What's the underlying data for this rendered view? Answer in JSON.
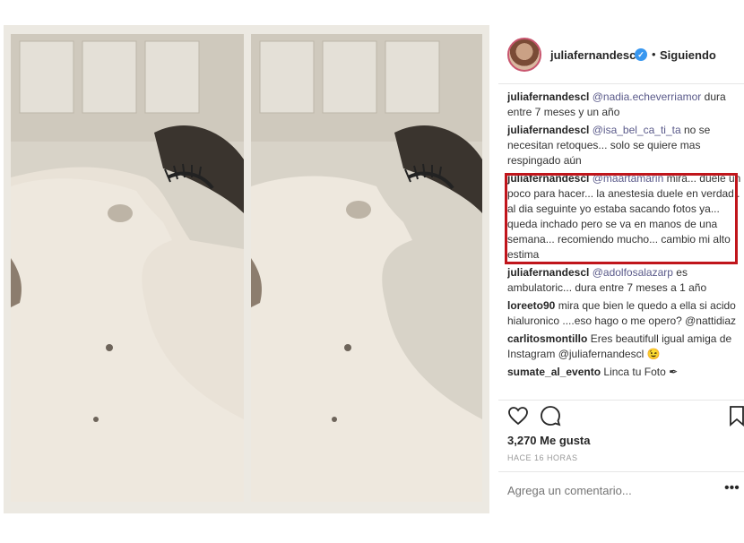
{
  "header": {
    "username": "juliafernandescl",
    "verified_symbol": "✓",
    "separator": "•",
    "follow_label": "Siguiendo"
  },
  "comments": [
    {
      "user": "juliafernandescl",
      "mention": "@nadia.echeverriamor",
      "text": "dura entre 7 meses y un año"
    },
    {
      "user": "juliafernandescl",
      "mention": "@isa_bel_ca_ti_ta",
      "text": "no se necesitan retoques... solo se quiere mas respingado aún"
    },
    {
      "user": "juliafernandescl",
      "mention": "@maartamarin",
      "text": "mira... duele un poco para hacer... la anestesia duele en verdad.. al dia seguinte yo estaba sacando fotos ya... queda inchado pero se va en manos de una semana... recomiendo mucho... cambio mi alto estima"
    },
    {
      "user": "juliafernandescl",
      "mention": "@adolfosalazarp",
      "text": "es ambulatoric... dura entre 7 meses a 1 año"
    },
    {
      "user": "loreeto90",
      "mention": "",
      "text": "mira que bien le quedo a ella si acido hialuronico ....eso hago o me opero? @nattidiaz"
    },
    {
      "user": "carlitosmontillo",
      "mention": "",
      "text": "Eres beautifull igual amiga de Instagram @juliafernandescl 😉"
    },
    {
      "user": "sumate_al_evento",
      "mention": "",
      "text": "Linca tu Foto ✒"
    }
  ],
  "likes": "3,270 Me gusta",
  "time": "HACE 16 HORAS",
  "add_comment_placeholder": "Agrega un comentario...",
  "more_symbol": "•••",
  "icons": {
    "like": "heart-icon",
    "comment": "comment-icon",
    "save": "bookmark-icon",
    "more": "more-icon",
    "verified": "verified-icon"
  }
}
